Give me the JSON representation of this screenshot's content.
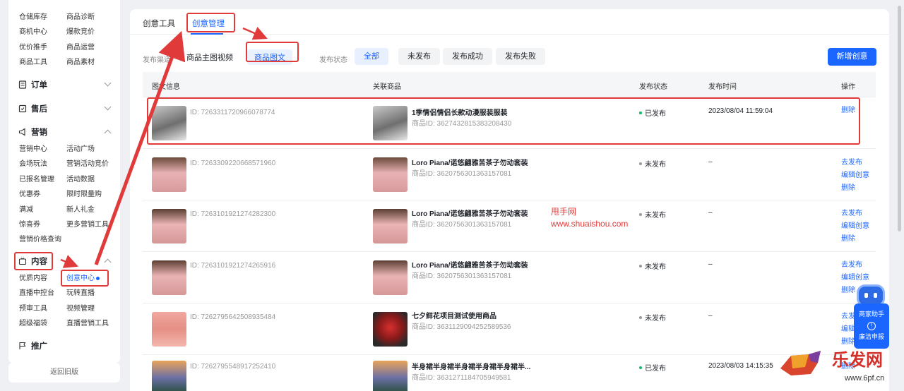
{
  "sidebar": {
    "top_links": [
      "仓储库存",
      "商品诊断",
      "商机中心",
      "爆款竞价",
      "优价推手",
      "商品运营",
      "商品工具",
      "商品素材"
    ],
    "sections": {
      "orders": "订单",
      "after_sales": "售后",
      "marketing": "营销",
      "content": "内容",
      "promotion": "推广"
    },
    "marketing_links": [
      "营销中心",
      "活动广场",
      "会场玩法",
      "营销活动竞价",
      "已报名管理",
      "活动数据",
      "优惠券",
      "限时限量购",
      "满减",
      "新人礼金",
      "惊喜券",
      "更多营销工具",
      "营销价格查询"
    ],
    "content_links": [
      "优质内容",
      "创意中心",
      "直播中控台",
      "玩转直播",
      "预审工具",
      "视频管理",
      "超级福袋",
      "直播营销工具"
    ],
    "back_label": "返回旧版"
  },
  "tabs": [
    "创意工具",
    "创意管理"
  ],
  "filters": {
    "channel_label": "发布渠道",
    "channels": [
      "商品主图视频",
      "商品图文"
    ],
    "status_label": "发布状态",
    "statuses": [
      "全部",
      "未发布",
      "发布成功",
      "发布失败"
    ],
    "new_button": "新增创意"
  },
  "table": {
    "headers": [
      "图文信息",
      "关联商品",
      "发布状态",
      "发布时间",
      "操作"
    ],
    "rows": [
      {
        "id": "ID: 7263311720966078774",
        "goods": "1季情侣情侣长款动漫服装服装",
        "goods_id": "商品ID: 3627432815383208430",
        "status": "已发布",
        "time": "2023/08/04 11:59:04",
        "actions": [
          "删除"
        ]
      },
      {
        "id": "ID: 7263309220668571960",
        "goods": "Loro Piana/诺悠翩雅苦茶子勿动套装",
        "goods_id": "商品ID: 3620756301363157081",
        "status": "未发布",
        "time": "–",
        "actions": [
          "去发布",
          "编辑创意",
          "删除"
        ]
      },
      {
        "id": "ID: 7263101921274282300",
        "goods": "Loro Piana/诺悠翩雅苦茶子勿动套装",
        "goods_id": "商品ID: 3620756301363157081",
        "status": "未发布",
        "time": "–",
        "actions": [
          "去发布",
          "编辑创意",
          "删除"
        ]
      },
      {
        "id": "ID: 7263101921274265916",
        "goods": "Loro Piana/诺悠翩雅苦茶子勿动套装",
        "goods_id": "商品ID: 3620756301363157081",
        "status": "未发布",
        "time": "–",
        "actions": [
          "去发布",
          "编辑创意",
          "删除"
        ]
      },
      {
        "id": "ID: 7262795642508935484",
        "goods": "七夕鲜花项目测试使用商品",
        "goods_id": "商品ID: 3631129094252589536",
        "status": "未发布",
        "time": "–",
        "actions": [
          "去发布",
          "编辑创意",
          "删除"
        ]
      },
      {
        "id": "ID: 7262795548917252410",
        "goods": "半身裙半身裙半身裙半身裙半身裙半...",
        "goods_id": "商品ID: 3631271184705949581",
        "status": "已发布",
        "time": "2023/08/03 14:15:35",
        "actions": [
          "删除"
        ]
      }
    ]
  },
  "watermark": {
    "line1": "甩手网",
    "line2": "www.shuaishou.com",
    "brand": "乐发网",
    "brand_url": "www.6pf.cn"
  },
  "assistant": {
    "helper": "商家助手",
    "report": "廉洁申报"
  },
  "colors": {
    "accent": "#1a66ff",
    "annotation": "#e13a3a",
    "published": "#12b76a",
    "unpublished": "#999999"
  }
}
